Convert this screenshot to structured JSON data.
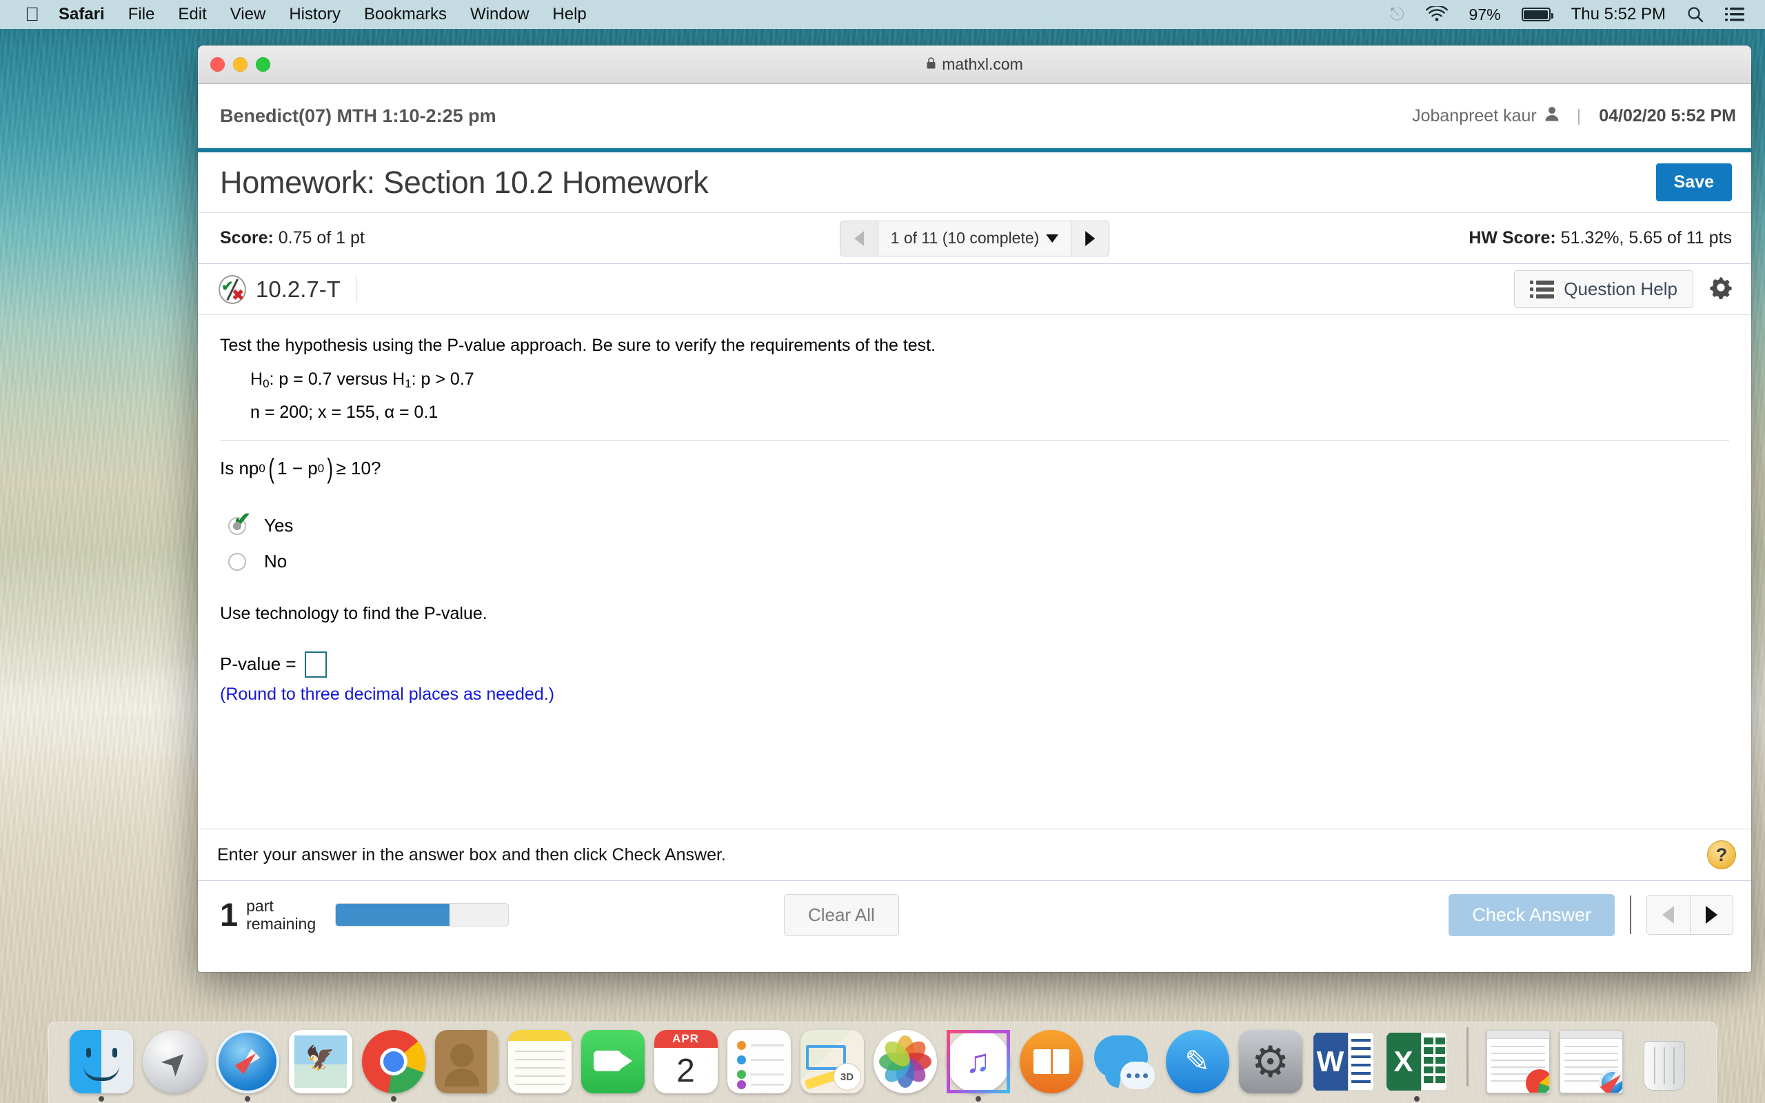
{
  "menubar": {
    "apple_logo": "apple-logo",
    "items": [
      {
        "label": "Safari",
        "bold": true
      },
      {
        "label": "File",
        "bold": false
      },
      {
        "label": "Edit",
        "bold": false
      },
      {
        "label": "View",
        "bold": false
      },
      {
        "label": "History",
        "bold": false
      },
      {
        "label": "Bookmarks",
        "bold": false
      },
      {
        "label": "Window",
        "bold": false
      },
      {
        "label": "Help",
        "bold": false
      }
    ],
    "status": {
      "bluetooth_icon": "bluetooth-icon",
      "wifi_icon": "wifi-icon",
      "battery_percent": "97%",
      "battery_icon": "battery-icon",
      "clock": "Thu 5:52 PM",
      "search_icon": "spotlight-search-icon",
      "notifications_icon": "notification-center-icon"
    }
  },
  "browser": {
    "url": "mathxl.com",
    "lock_icon": "lock-icon",
    "traffic_lights": [
      "close-red",
      "minimize-yellow",
      "maximize-green"
    ]
  },
  "course_header": {
    "course_title": "Benedict(07) MTH 1:10-2:25 pm",
    "user_name": "Jobanpreet kaur",
    "user_icon": "person-icon",
    "separator": "|",
    "datetime": "04/02/20 5:52 PM"
  },
  "assignment": {
    "title": "Homework: Section 10.2 Homework",
    "save_label": "Save",
    "score_label": "Score:",
    "score_value": "0.75 of 1 pt",
    "pager": {
      "prev_icon": "chevron-left-icon",
      "next_icon": "chevron-right-icon",
      "text": "1 of 11 (10 complete)",
      "dropdown_icon": "chevron-down-icon"
    },
    "hw_score_label": "HW Score:",
    "hw_score_value": "51.32%, 5.65 of 11 pts"
  },
  "question_bar": {
    "status_icon": "check-x-partial-credit-icon",
    "number": "10.2.7-T",
    "help_label": "Question Help",
    "help_icon": "list-icon",
    "settings_icon": "gear-icon"
  },
  "question": {
    "prompt": "Test the hypothesis using the P-value approach. Be sure to verify the requirements of the test.",
    "hypothesis": {
      "h_null": "H",
      "h_null_sub": "0",
      "h_null_rest": ": p = 0.7 versus H",
      "h_alt_sub": "1",
      "h_alt_rest": ": p > 0.7"
    },
    "given": "n = 200; x = 155, α = 0.1",
    "requirement_question": {
      "lead": "Is np",
      "sub1": "0",
      "open_paren": "(",
      "mid": "1 − p",
      "sub2": "0",
      "close_paren": ")",
      "tail": " ≥ 10?"
    },
    "options": [
      {
        "label": "Yes",
        "selected": true,
        "graded_correct": true
      },
      {
        "label": "No",
        "selected": false,
        "graded_correct": false
      }
    ],
    "instruction_pvalue": "Use technology to find the P-value.",
    "pvalue_label": "P-value =",
    "pvalue_answer": "",
    "pvalue_placeholder": "",
    "rounding_note": "(Round to three decimal places as needed.)"
  },
  "instruction_bar": {
    "text": "Enter your answer in the answer box and then click Check Answer.",
    "help_icon": "question-mark-help-icon"
  },
  "footer": {
    "parts_number": "1",
    "parts_label_line1": "part",
    "parts_label_line2": "remaining",
    "progress_percent": 66,
    "clear_all_label": "Clear All",
    "check_answer_label": "Check Answer",
    "prev_icon": "triangle-left-icon",
    "next_icon": "triangle-right-icon"
  },
  "dock": {
    "items": [
      {
        "name": "finder",
        "running": true
      },
      {
        "name": "launchpad",
        "running": false
      },
      {
        "name": "safari",
        "running": true
      },
      {
        "name": "mail",
        "running": false
      },
      {
        "name": "google-chrome",
        "running": true
      },
      {
        "name": "contacts",
        "running": false
      },
      {
        "name": "notes",
        "running": false
      },
      {
        "name": "facetime",
        "running": false
      },
      {
        "name": "calendar",
        "running": false,
        "month": "APR",
        "day": "2"
      },
      {
        "name": "reminders",
        "running": false
      },
      {
        "name": "maps",
        "running": false,
        "label": "3D"
      },
      {
        "name": "photos",
        "running": false
      },
      {
        "name": "itunes",
        "running": true
      },
      {
        "name": "ibooks",
        "running": false
      },
      {
        "name": "messages",
        "running": false
      },
      {
        "name": "app-store",
        "running": false
      },
      {
        "name": "system-preferences",
        "running": false
      },
      {
        "name": "microsoft-word",
        "running": false,
        "letter": "W"
      },
      {
        "name": "microsoft-excel",
        "running": true,
        "letter": "X"
      }
    ],
    "minimized": [
      {
        "name": "minimized-chrome-window"
      },
      {
        "name": "minimized-safari-window"
      }
    ],
    "trash": {
      "name": "trash"
    }
  },
  "colors": {
    "accent_teal": "#15789a",
    "save_blue": "#1179bf",
    "progress_blue": "#3f8ecc",
    "check_answer_blue": "#a7cbe6",
    "note_blue": "#1417d6",
    "answer_box_border": "#1b6f82"
  }
}
